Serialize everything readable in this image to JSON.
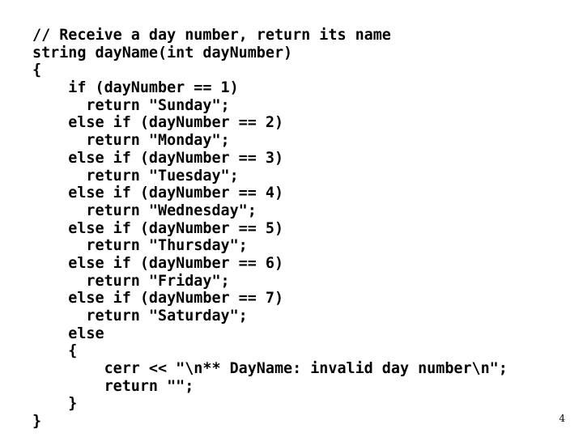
{
  "slide": {
    "background_color": "#ffffff",
    "text_color": "#000000",
    "page_number": "4",
    "language": "cpp"
  },
  "code": {
    "lines": [
      "// Receive a day number, return its name",
      "string dayName(int dayNumber)",
      "{",
      "    if (dayNumber == 1)",
      "      return \"Sunday\";",
      "    else if (dayNumber == 2)",
      "      return \"Monday\";",
      "    else if (dayNumber == 3)",
      "      return \"Tuesday\";",
      "    else if (dayNumber == 4)",
      "      return \"Wednesday\";",
      "    else if (dayNumber == 5)",
      "      return \"Thursday\";",
      "    else if (dayNumber == 6)",
      "      return \"Friday\";",
      "    else if (dayNumber == 7)",
      "      return \"Saturday\";",
      "    else",
      "    {",
      "        cerr << \"\\n** DayName: invalid day number\\n\";",
      "        return \"\";",
      "    }",
      "}"
    ]
  }
}
